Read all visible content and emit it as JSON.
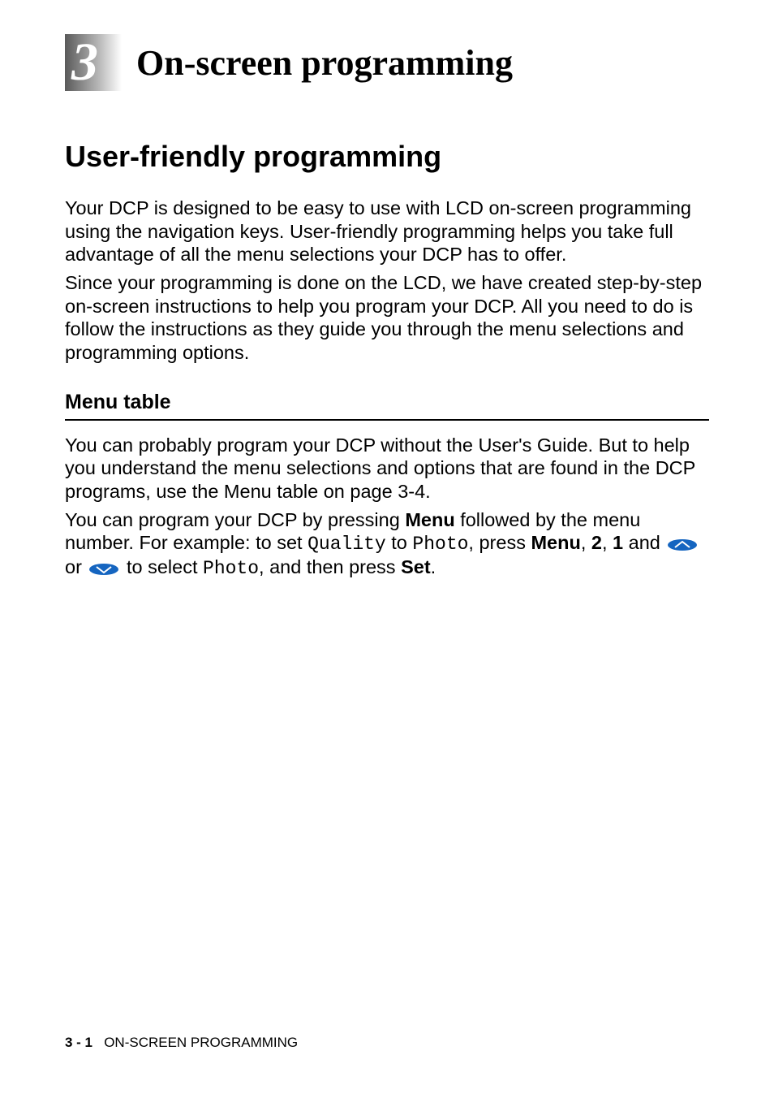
{
  "chapter": {
    "number": "3",
    "title": "On-screen programming"
  },
  "section": {
    "title": "User-friendly programming",
    "para1": "Your DCP is designed to be easy to use with LCD on-screen programming using the navigation keys. User-friendly programming helps you take full advantage of all the menu selections your DCP has to offer.",
    "para2": "Since your programming is done on the LCD, we have created step-by-step on-screen instructions to help you program your DCP. All you need to do is follow the instructions as they guide you through the menu selections and programming options."
  },
  "subsection": {
    "title": "Menu table",
    "para1": "You can probably program your DCP without the User's Guide. But to help you understand the menu selections and options that are found in the DCP programs, use the Menu table on page 3-4.",
    "p2_pre": "You can program your DCP by pressing ",
    "p2_menu": "Menu",
    "p2_mid1": " followed by the menu number. For example: to set ",
    "p2_quality": "Quality",
    "p2_to": " to ",
    "p2_photo1": "Photo",
    "p2_press": ", press ",
    "p2_menu2": "Menu",
    "p2_comma1": ", ",
    "p2_two": "2",
    "p2_comma2": ", ",
    "p2_one": "1",
    "p2_and": " and ",
    "p2_or": " or ",
    "p2_select": " to select ",
    "p2_photo2": "Photo",
    "p2_then": ", and then press ",
    "p2_set": "Set",
    "p2_end": "."
  },
  "footer": {
    "page": "3 - 1",
    "title": "ON-SCREEN PROGRAMMING"
  }
}
